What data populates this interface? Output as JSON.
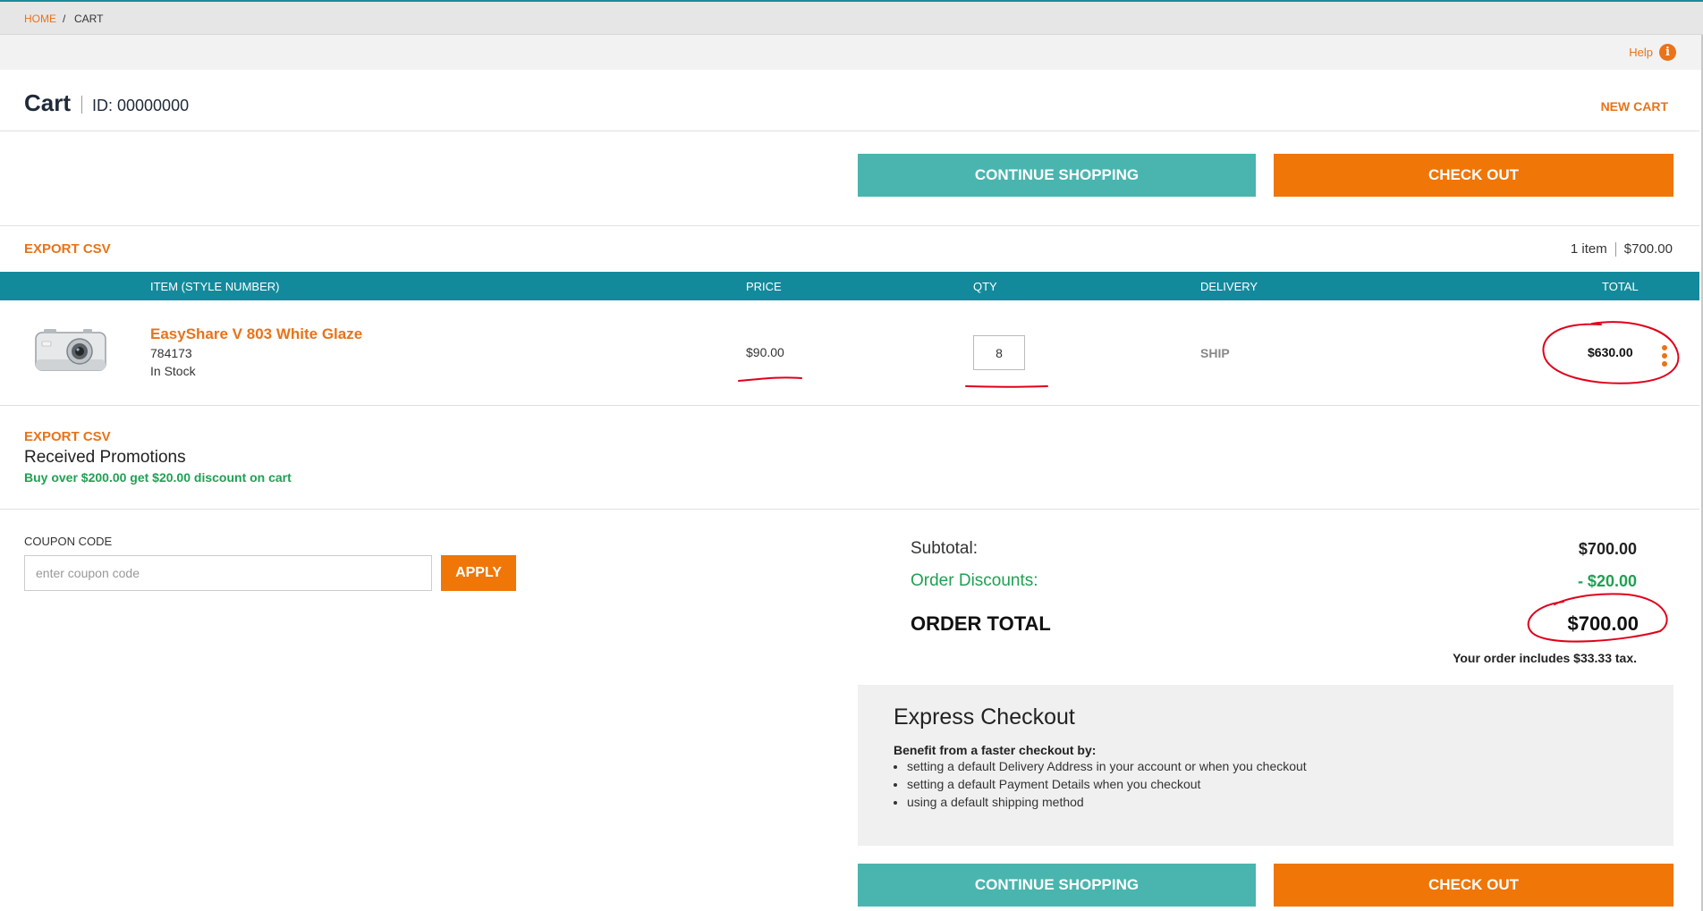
{
  "breadcrumb": {
    "home": "HOME",
    "separator": "/",
    "current": "CART"
  },
  "help": {
    "label": "Help",
    "icon": "info-icon"
  },
  "header": {
    "title": "Cart",
    "id_label": "ID: 00000000",
    "new_cart": "NEW CART"
  },
  "actions": {
    "continue_shopping": "CONTINUE SHOPPING",
    "check_out": "CHECK OUT"
  },
  "export_csv": "EXPORT CSV",
  "cart_summary": {
    "items": "1 item",
    "amount": "$700.00"
  },
  "table": {
    "columns": [
      "ITEM (STYLE NUMBER)",
      "PRICE",
      "QTY",
      "DELIVERY",
      "TOTAL"
    ],
    "rows": [
      {
        "name": "EasyShare V 803 White Glaze",
        "sku": "784173",
        "stock": "In Stock",
        "price": "$90.00",
        "qty": "8",
        "delivery": "SHIP",
        "total": "$630.00",
        "image": "camera-image"
      }
    ]
  },
  "promotions": {
    "title": "Received Promotions",
    "items": [
      "Buy over $200.00 get $20.00 discount on cart"
    ]
  },
  "coupon": {
    "label": "COUPON CODE",
    "placeholder": "enter coupon code",
    "apply": "APPLY"
  },
  "totals": {
    "subtotal_label": "Subtotal:",
    "subtotal": "$700.00",
    "discounts_label": "Order Discounts:",
    "discounts": "- $20.00",
    "order_total_label": "ORDER TOTAL",
    "order_total": "$700.00",
    "tax_note": "Your order includes $33.33 tax."
  },
  "express": {
    "title": "Express Checkout",
    "benefit": "Benefit from a faster checkout by:",
    "items": [
      "setting a default Delivery Address in your account or when you checkout",
      "setting a default Payment Details when you checkout",
      "using a default shipping method"
    ]
  },
  "colors": {
    "accent_orange": "#ef7607",
    "accent_teal": "#49b5ae",
    "table_header": "#138a9c",
    "promo_green": "#20a053",
    "annotation_red": "#e0001a"
  }
}
